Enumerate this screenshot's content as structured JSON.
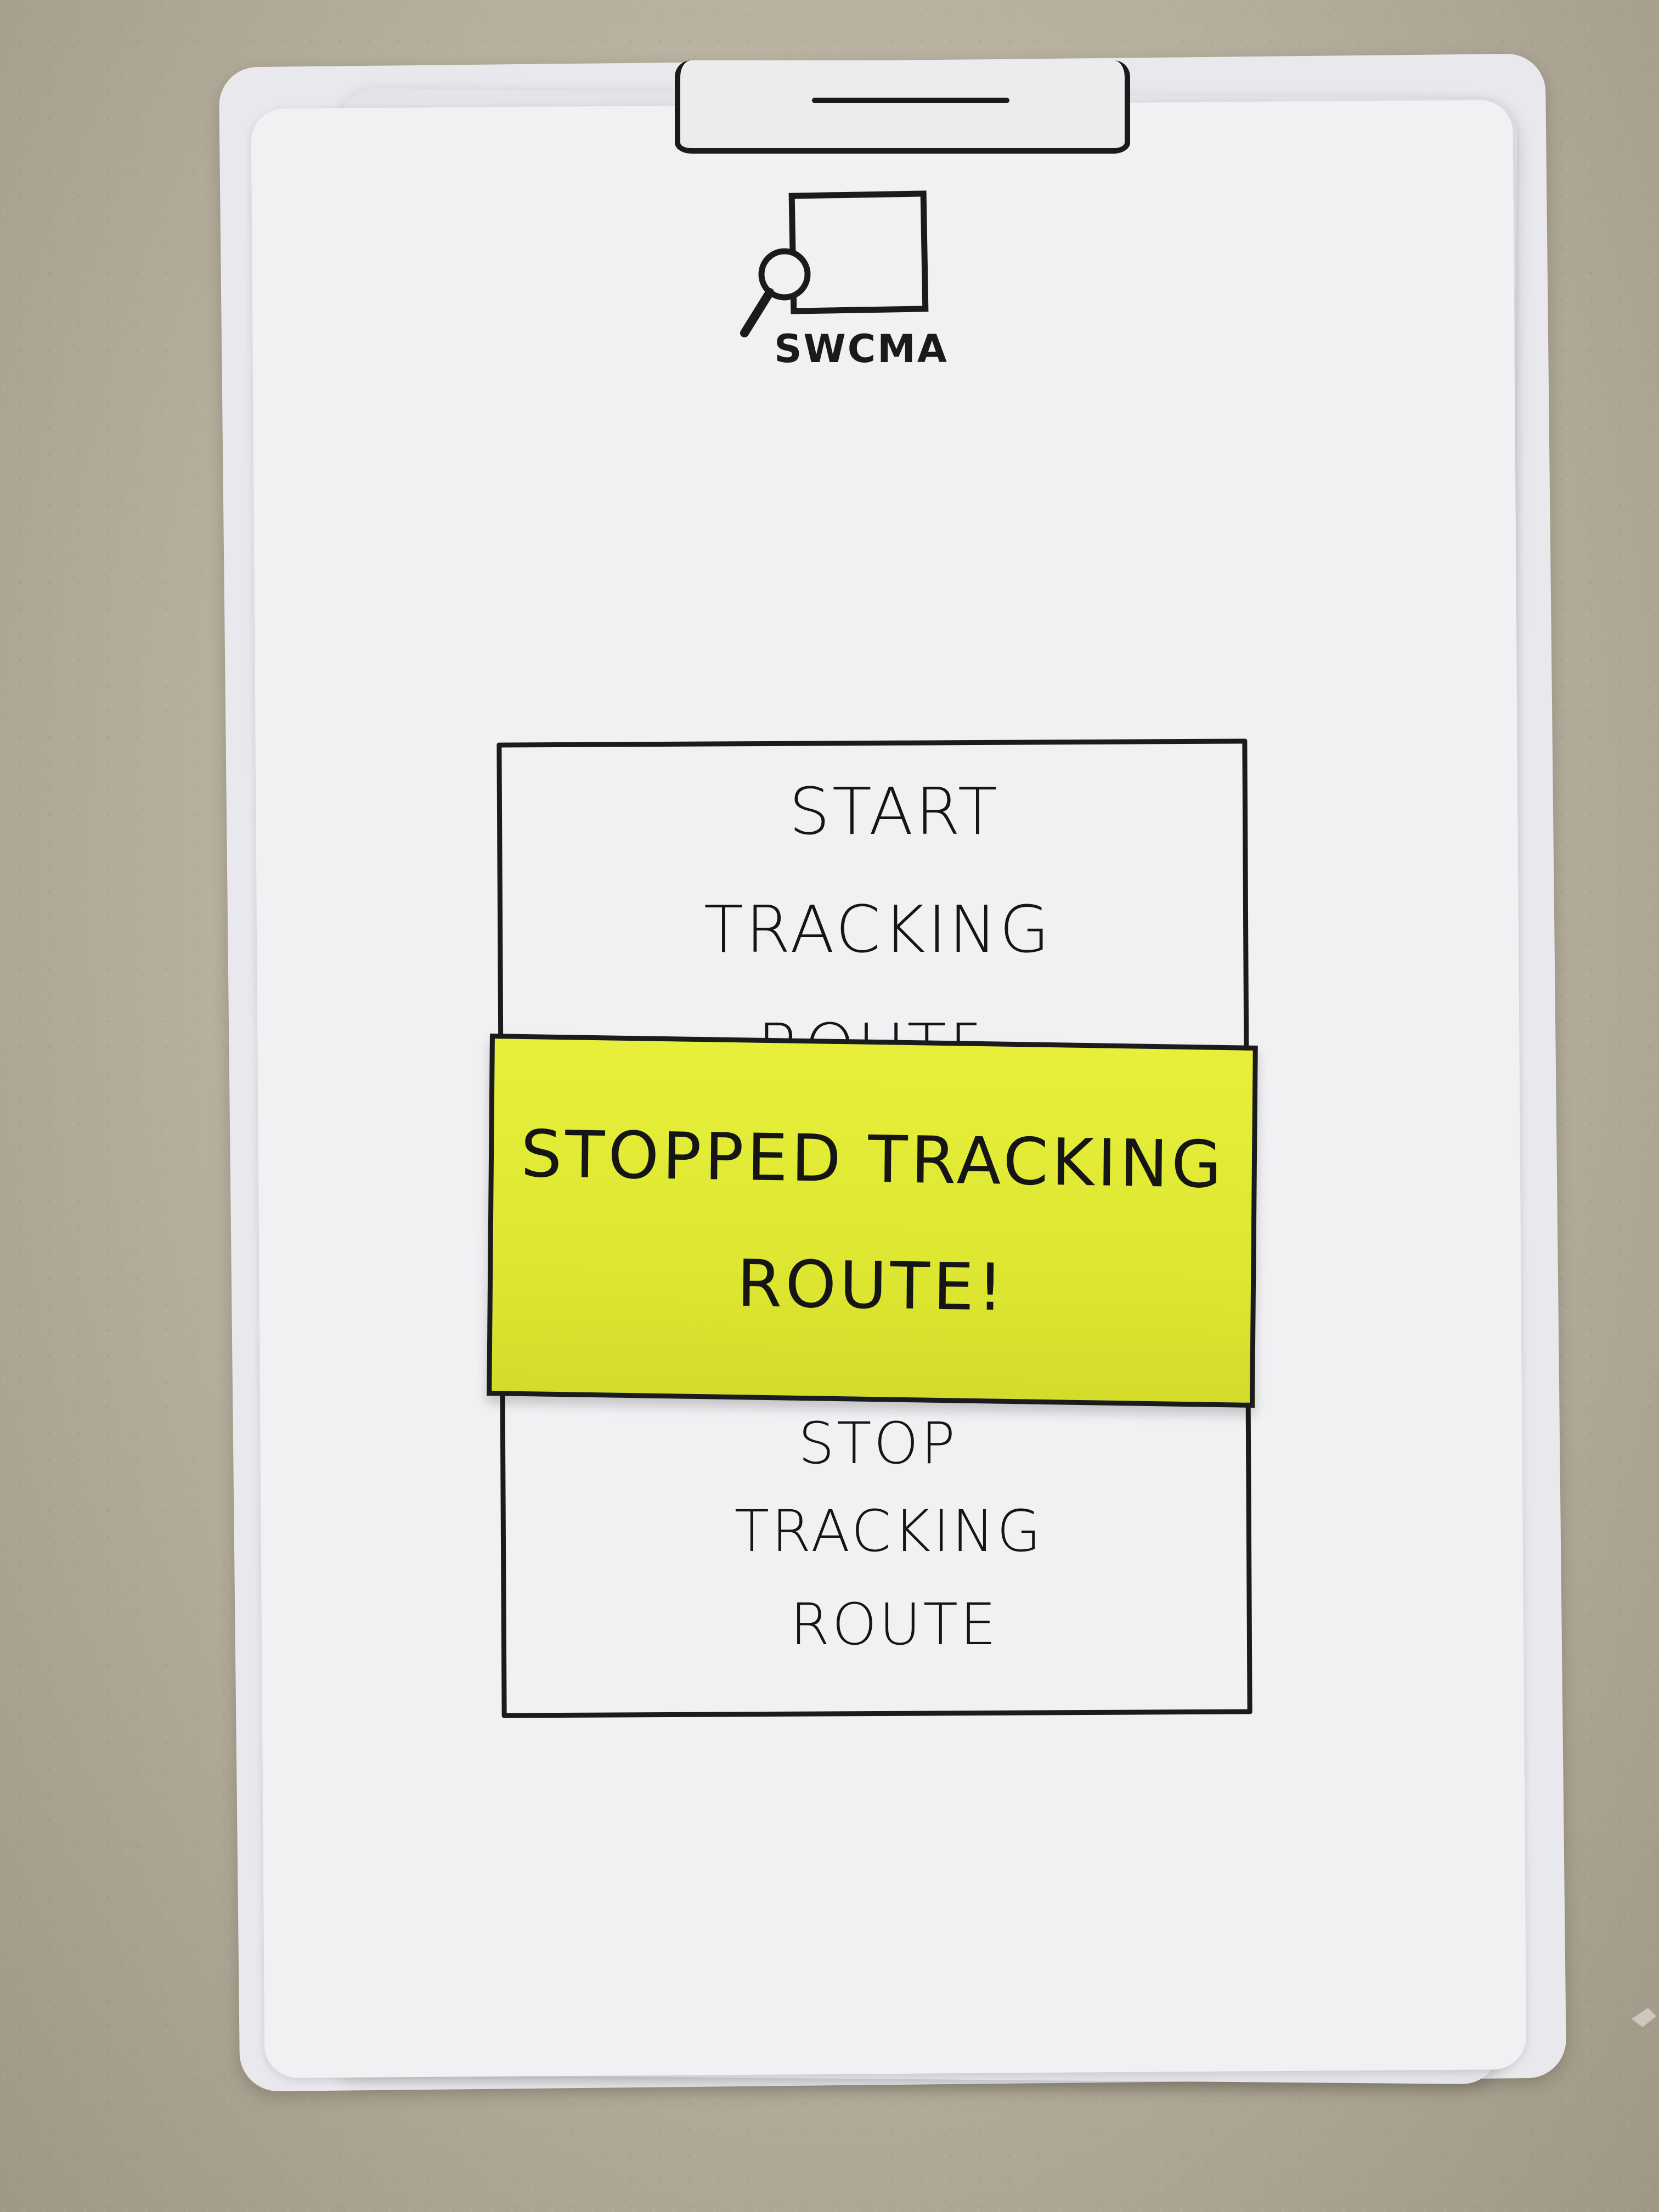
{
  "app": {
    "logo_text": "SWCMA",
    "logo_icon": "search-magnifier-icon"
  },
  "main_button": {
    "line1": "START",
    "line2": "TRACKING",
    "line3": "ROUTE"
  },
  "lower_button": {
    "line1": "STOP",
    "line2": "TRACKING",
    "line3": "ROUTE"
  },
  "sticky_note": {
    "line1": "STOPPED TRACKING",
    "line2": "ROUTE!",
    "color": "#E3EC38"
  },
  "colors": {
    "ink": "#1B1B1B",
    "paper": "#F1F0F3",
    "wall": "#B7B09F"
  }
}
